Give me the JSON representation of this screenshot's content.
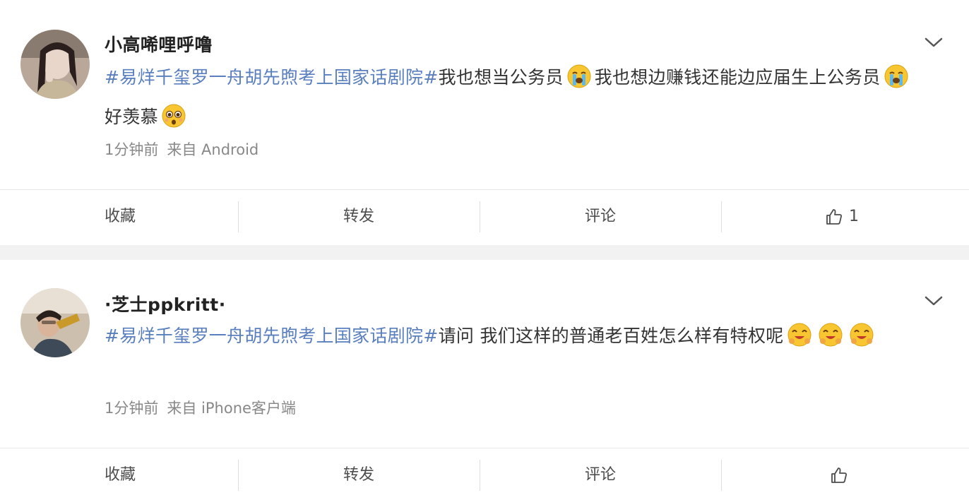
{
  "posts": [
    {
      "username": "小高唏哩呼噜",
      "avatar": "avatar-woman-icon",
      "content": [
        {
          "type": "hashtag",
          "text": "#易烊千玺罗一舟胡先煦考上国家话剧院#"
        },
        {
          "type": "text",
          "text": "我也想当公务员"
        },
        {
          "type": "emoji",
          "name": "crying-face-icon"
        },
        {
          "type": "text",
          "text": "我也想边赚钱还能边应届生上公务员"
        },
        {
          "type": "emoji",
          "name": "crying-face-icon"
        },
        {
          "type": "text",
          "text": "好羡慕"
        },
        {
          "type": "emoji",
          "name": "pleading-face-icon"
        }
      ],
      "time": "1分钟前",
      "source": "来自 Android",
      "actions": {
        "collect": "收藏",
        "repost": "转发",
        "comment": "评论",
        "like_count": "1"
      }
    },
    {
      "username": "·芝士ppkritt·",
      "avatar": "avatar-man-icon",
      "content": [
        {
          "type": "hashtag",
          "text": "#易烊千玺罗一舟胡先煦考上国家话剧院#"
        },
        {
          "type": "text",
          "text": "请问 我们这样的普通老百姓怎么样有特权呢"
        },
        {
          "type": "emoji",
          "name": "hugging-face-icon"
        },
        {
          "type": "emoji",
          "name": "hugging-face-icon"
        },
        {
          "type": "emoji",
          "name": "hugging-face-icon"
        }
      ],
      "time": "1分钟前",
      "source": "来自 iPhone客户端",
      "actions": {
        "collect": "收藏",
        "repost": "转发",
        "comment": "评论",
        "like_count": ""
      }
    }
  ],
  "colors": {
    "hashtag": "#5a7fbf",
    "text": "#333333",
    "meta": "#888888",
    "background": "#f2f2f2"
  }
}
